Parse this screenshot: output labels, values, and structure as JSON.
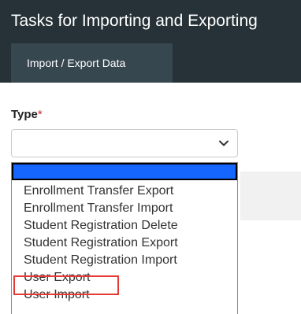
{
  "window": {
    "title": "Tasks for Importing and Exporting"
  },
  "tabs": [
    {
      "label": "Import / Export Data",
      "active": true
    }
  ],
  "form": {
    "type_label": "Type",
    "required_marker": "*",
    "selected_value": "",
    "chevron_icon": "chevron-down-icon"
  },
  "dropdown": {
    "options": [
      "",
      "Enrollment Transfer Export",
      "Enrollment Transfer Import",
      "Student Registration Delete",
      "Student Registration Export",
      "Student Registration Import",
      "User Export",
      "User Import"
    ],
    "highlighted_index": 0,
    "annotated_option": "User Export"
  },
  "colors": {
    "header_bg": "#263238",
    "tab_active_bg": "#37474f",
    "selection_blue": "#1565ff",
    "required_red": "#c62828",
    "annotation_red": "#e53935"
  }
}
